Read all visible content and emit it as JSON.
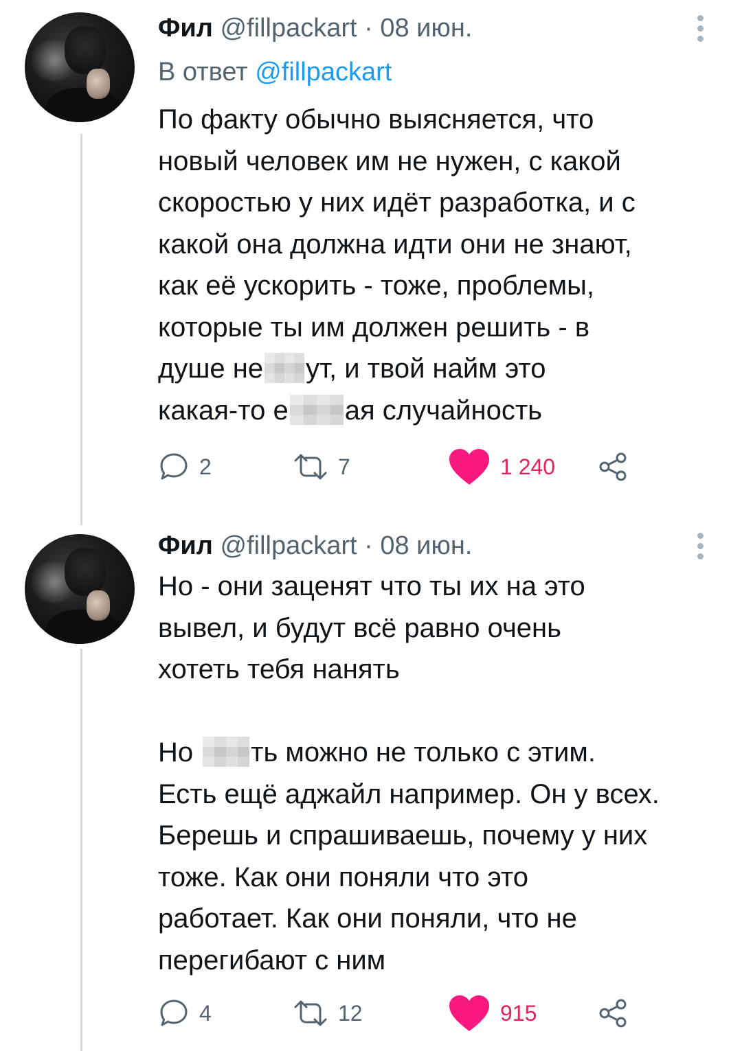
{
  "colors": {
    "accent": "#1d9bf0",
    "like": "#f91880",
    "like_count": "#e0245e",
    "muted_text": "#536471",
    "thread_line": "#cfd9de"
  },
  "tweets": [
    {
      "author": {
        "name": "Фил",
        "handle": "@fillpackart",
        "separator": "·",
        "date": "08 июн."
      },
      "reply_to": {
        "prefix": "В ответ",
        "handle": "@fillpackart"
      },
      "lines": [
        "По факту обычно выясняется, что",
        "новый человек им не нужен, с какой",
        "скоростью у них идёт разработка, и с",
        "какой она должна идти они не знают,",
        "как её ускорить - тоже, проблемы,",
        "которые ты им должен решить - в"
      ],
      "censored_lines": [
        {
          "before": "душе не",
          "after": "ут, и твой найм это"
        },
        {
          "before": "какая-то е",
          "after": "ая случайность"
        }
      ],
      "actions": {
        "reply_icon": "reply-icon",
        "reply_count": "2",
        "retweet_icon": "retweet-icon",
        "retweet_count": "7",
        "like_icon": "heart-icon",
        "like_count": "1 240",
        "share_icon": "share-icon"
      }
    },
    {
      "author": {
        "name": "Фил",
        "handle": "@fillpackart",
        "separator": "·",
        "date": "08 июн."
      },
      "lines_a": [
        "Но - они заценят что ты их на это",
        "вывел, и будут всё равно очень",
        "хотеть тебя нанять"
      ],
      "censored_line": {
        "before": "Но",
        "after": "ть можно не только с этим."
      },
      "lines_b": [
        "Есть ещё аджайл например. Он у всех.",
        "Берешь и спрашиваешь, почему у них",
        "тоже. Как они поняли что это",
        "работает. Как они поняли, что не",
        "перегибают с ним"
      ],
      "actions": {
        "reply_icon": "reply-icon",
        "reply_count": "4",
        "retweet_icon": "retweet-icon",
        "retweet_count": "12",
        "like_icon": "heart-icon",
        "like_count": "915",
        "share_icon": "share-icon"
      }
    }
  ]
}
